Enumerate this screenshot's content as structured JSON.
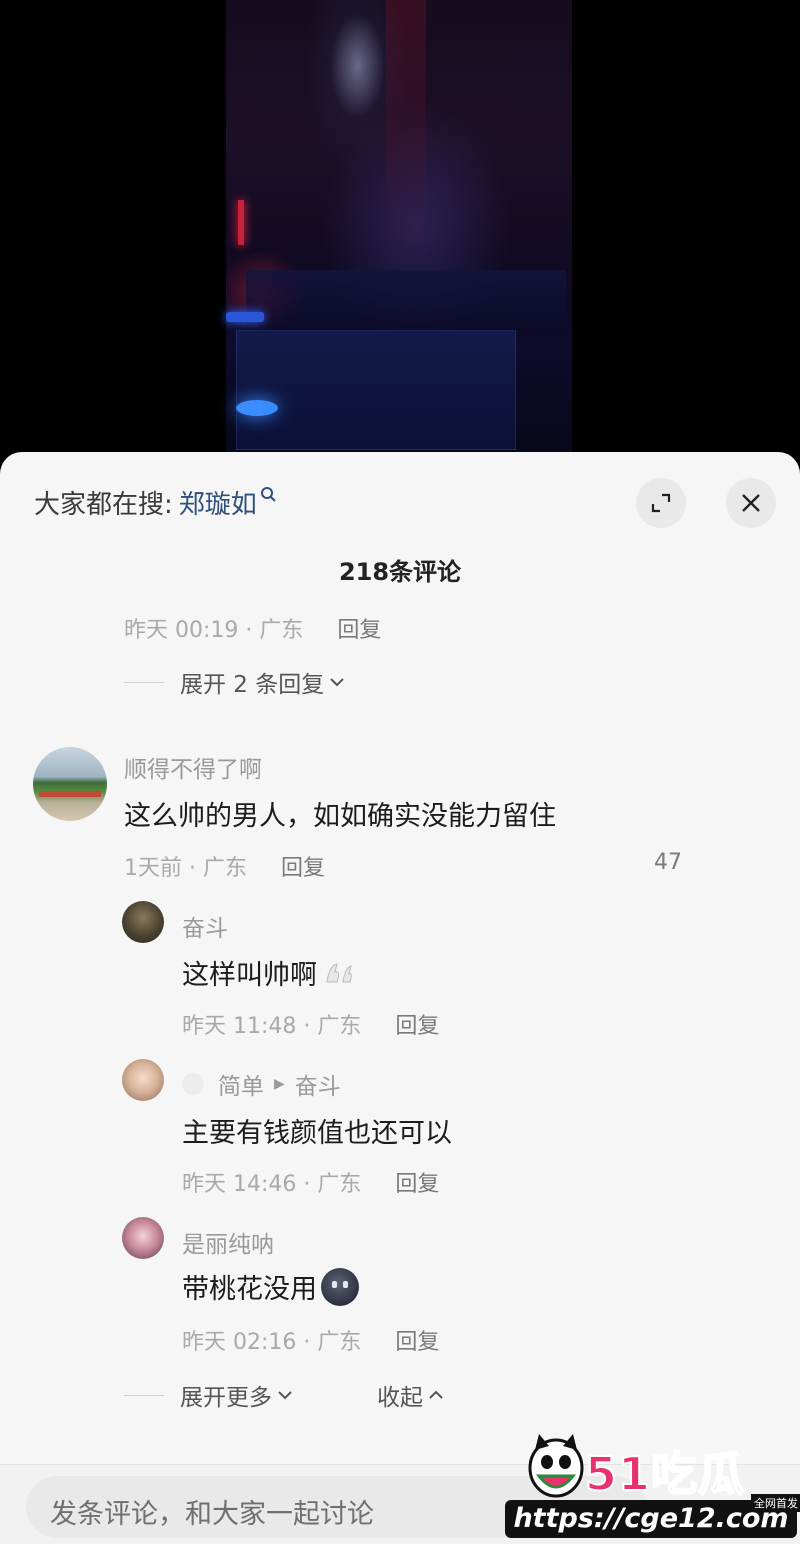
{
  "search": {
    "prefix": "大家都在搜:",
    "term": "郑璇如"
  },
  "comments_header": "218条评论",
  "prev_meta": {
    "time_loc": "昨天 00:19 · 广东",
    "reply": "回复"
  },
  "expand_prev": "展开 2 条回复",
  "main_comment": {
    "user": "顺得不得了啊",
    "text": "这么帅的男人，如如确实没能力留住",
    "time_loc": "1天前 · 广东",
    "reply": "回复",
    "likes": "47"
  },
  "replies": [
    {
      "user": "奋斗",
      "text": "这样叫帅啊",
      "time_loc": "昨天 11:48 · 广东",
      "reply": "回复"
    },
    {
      "user": "简单",
      "target": "奋斗",
      "text": "主要有钱颜值也还可以",
      "time_loc": "昨天 14:46 · 广东",
      "reply": "回复"
    },
    {
      "user": "是丽纯呐",
      "text": "带桃花没用",
      "time_loc": "昨天 02:16 · 广东",
      "reply": "回复"
    }
  ],
  "expand_more": "展开更多",
  "collapse": "收起",
  "input": {
    "placeholder": "发条评论，和大家一起讨论"
  },
  "watermark": {
    "brand": "51吃瓜",
    "tag": "全网首发",
    "url": "https://cge12.com"
  },
  "colors": {
    "search_term": "#2f4f7e",
    "watermark_pink": "#e8326c",
    "sheet_bg": "#f6f6f6"
  }
}
